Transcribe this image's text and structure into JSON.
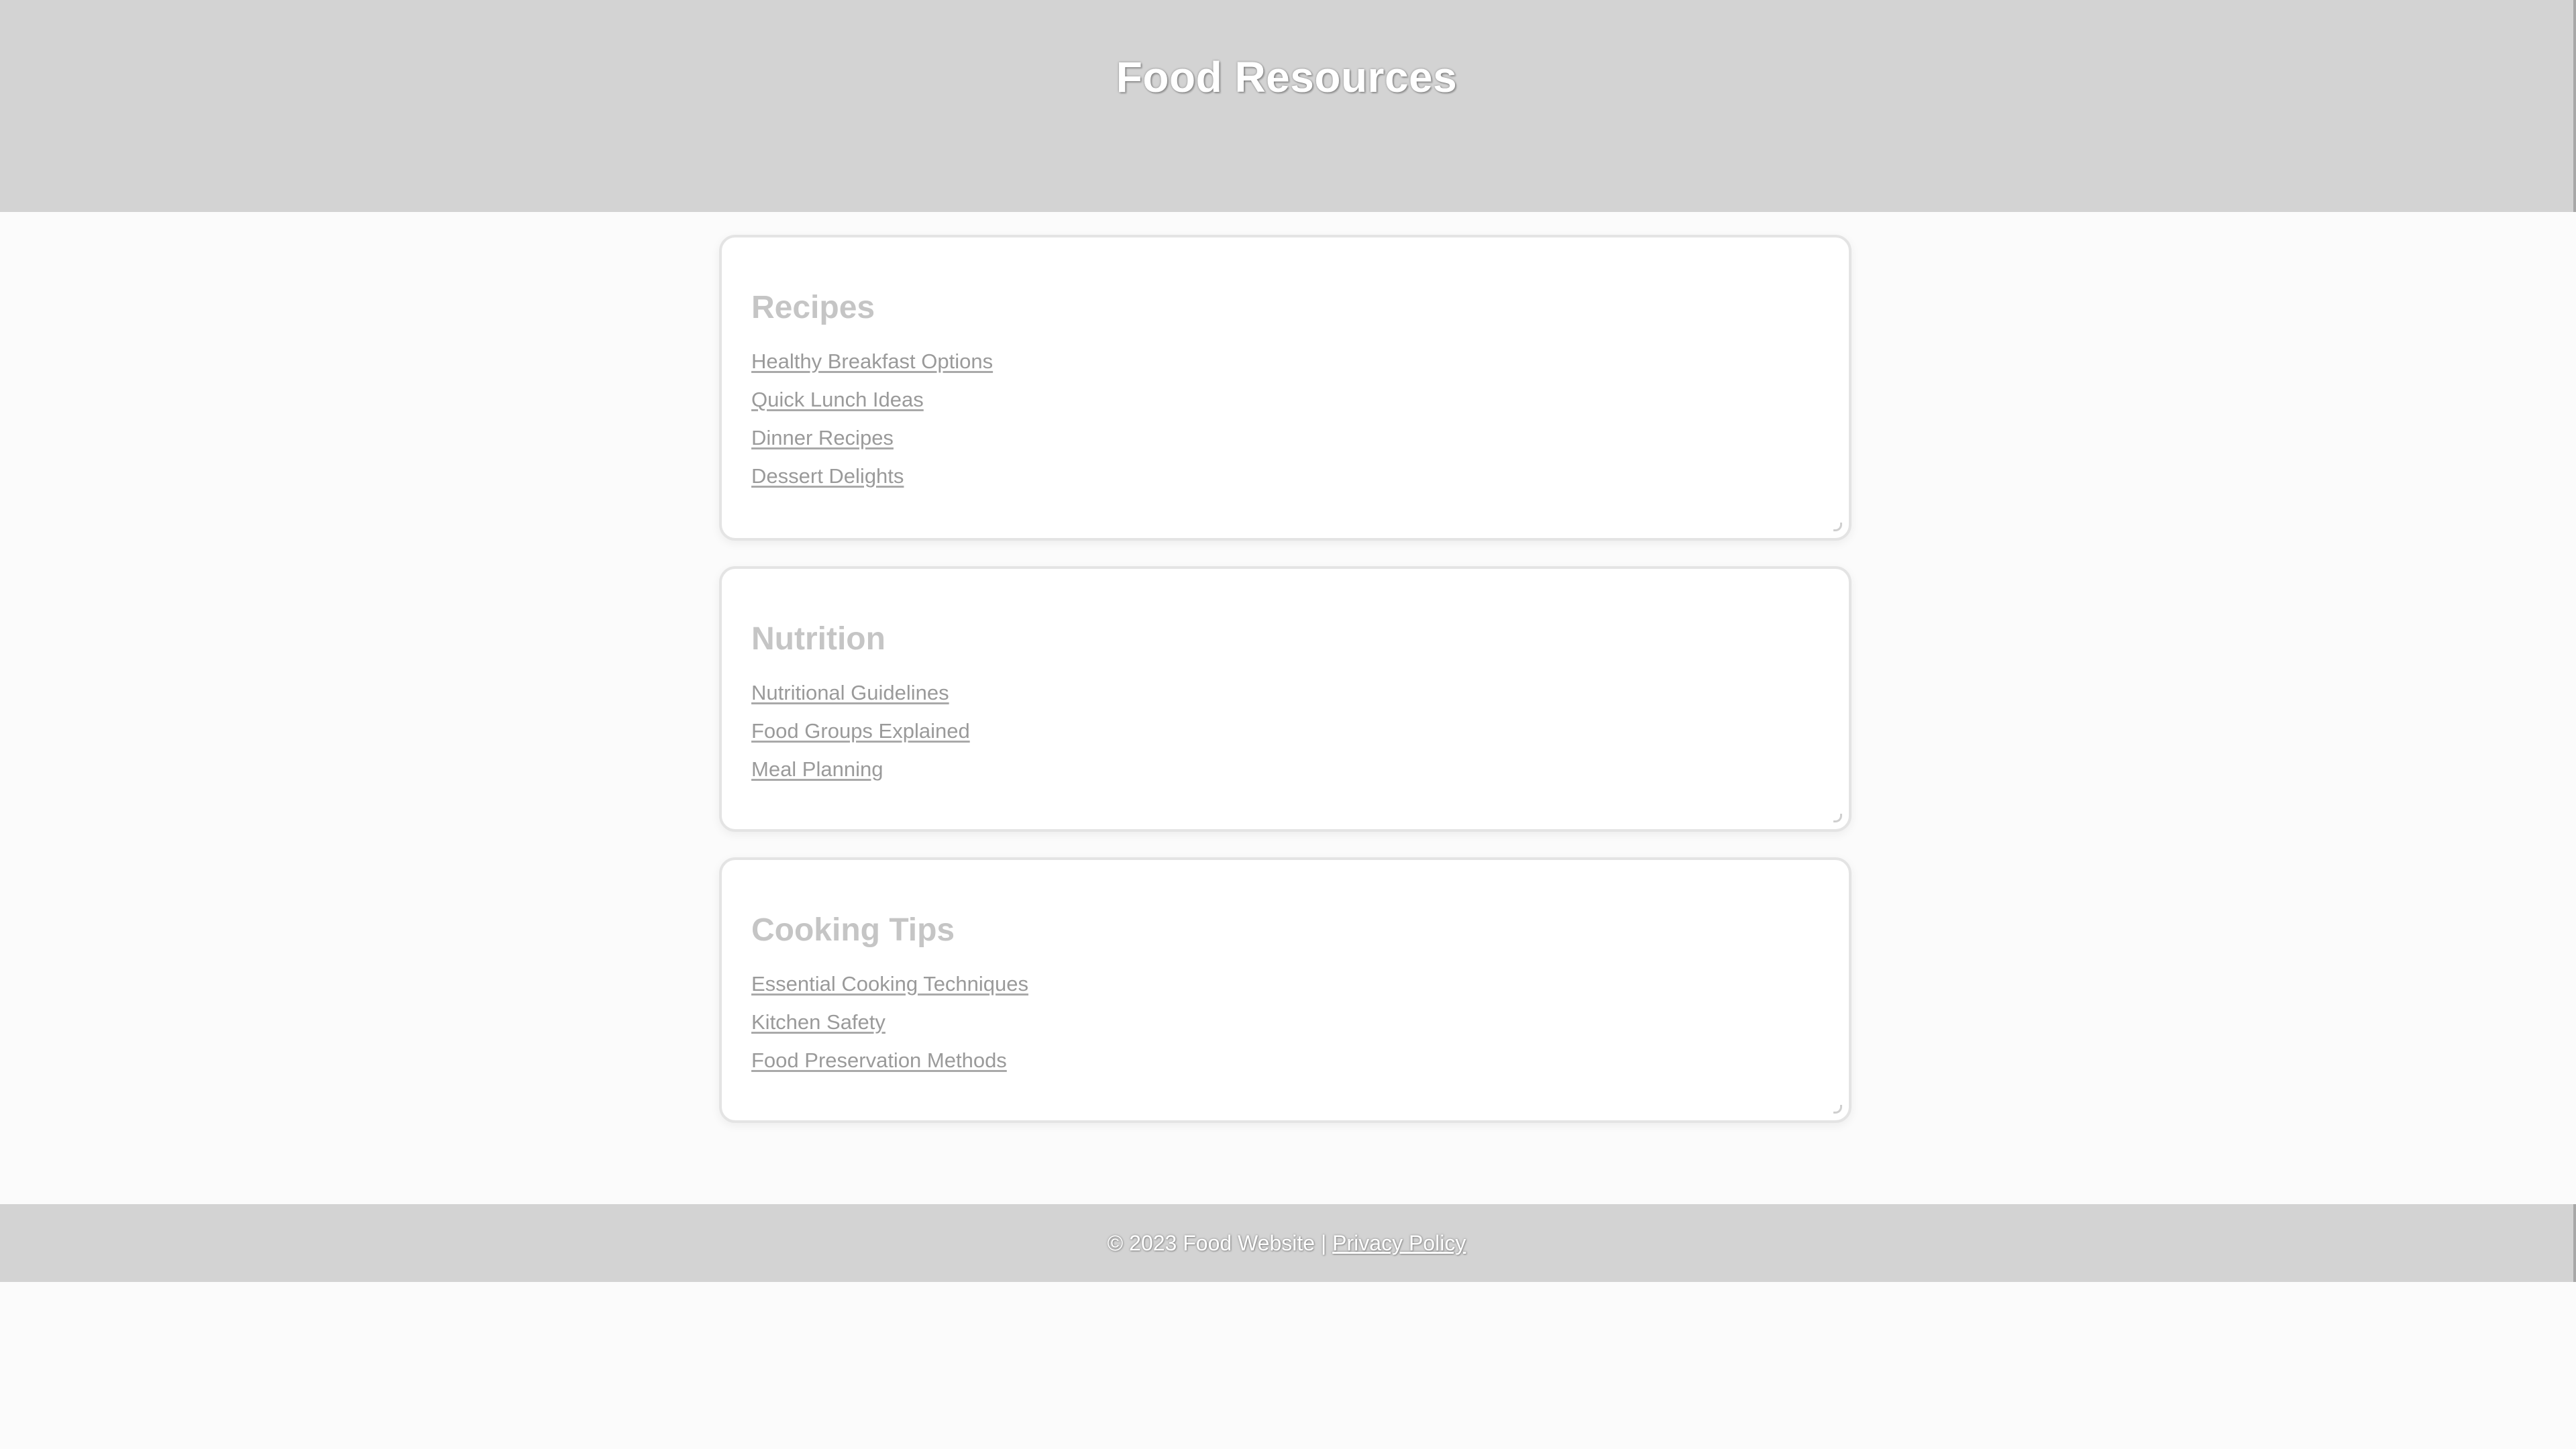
{
  "header": {
    "title": "Food Resources"
  },
  "sections": [
    {
      "title": "Recipes",
      "links": [
        "Healthy Breakfast Options",
        "Quick Lunch Ideas",
        "Dinner Recipes",
        "Dessert Delights"
      ]
    },
    {
      "title": "Nutrition",
      "links": [
        "Nutritional Guidelines",
        "Food Groups Explained",
        "Meal Planning"
      ]
    },
    {
      "title": "Cooking Tips",
      "links": [
        "Essential Cooking Techniques",
        "Kitchen Safety",
        "Food Preservation Methods"
      ]
    }
  ],
  "footer": {
    "copyright": "© 2023 Food Website",
    "separator": "|",
    "privacy_label": "Privacy Policy"
  },
  "colors": {
    "header_bg": "#d3d3d3",
    "page_bg": "#fbfbfb",
    "card_bg": "#ffffff",
    "heading_text": "#c5c5c5",
    "link_text": "#9a9a9a"
  }
}
